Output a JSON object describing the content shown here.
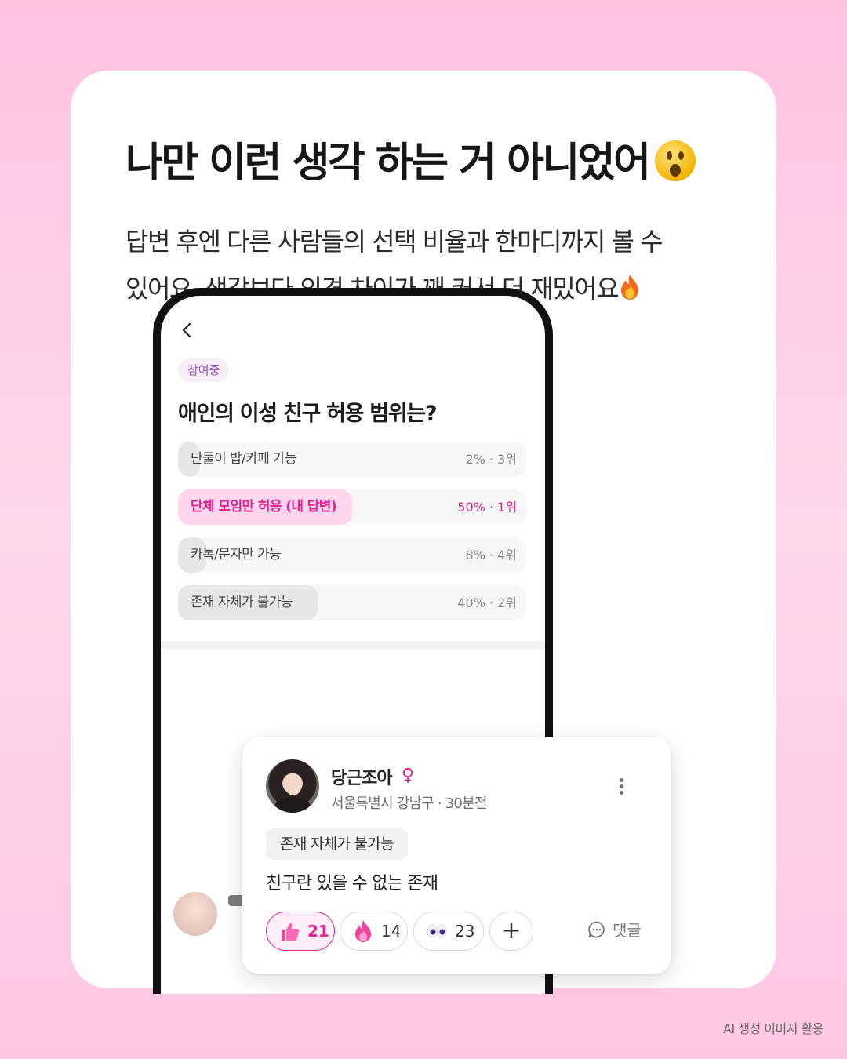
{
  "headline": "나만 이런 생각 하는 거 아니었어",
  "description": {
    "line1": "답변 후엔 다른 사람들의 선택 비율과 한마디까지 볼 수",
    "line2": "있어요. 생각보다 의견 차이가 꽤 커서 더 재밌어요"
  },
  "poll": {
    "status_badge": "참여중",
    "question": "애인의 이성 친구 허용 범위는?",
    "options": [
      {
        "label": "단둘이 밥/카페 가능",
        "stat": "2% · 3위",
        "percent": 2,
        "mine": false
      },
      {
        "label": "단체 모임만 허용 (내 답변)",
        "stat": "50% · 1위",
        "percent": 50,
        "mine": true
      },
      {
        "label": "카톡/문자만 가능",
        "stat": "8% · 4위",
        "percent": 8,
        "mine": false
      },
      {
        "label": "존재 자체가 불가능",
        "stat": "40% · 2위",
        "percent": 40,
        "mine": false
      }
    ]
  },
  "comment": {
    "user_name": "당근조아",
    "gender_symbol": "♀",
    "meta": "서울특별시 강남구 · 30분전",
    "choice": "존재 자체가 불가능",
    "text": "친구란 있을 수 없는 존재",
    "reactions": [
      {
        "icon": "thumbs-up-icon",
        "count": "21",
        "active": true
      },
      {
        "icon": "fire-icon",
        "count": "14",
        "active": false
      },
      {
        "icon": "eyes-icon",
        "count": "23",
        "active": false
      }
    ],
    "add_reaction": "+",
    "reply_label": "댓글"
  },
  "footnote": "AI 생성 이미지 활용",
  "colors": {
    "accent": "#e5208f",
    "accent_fill": "#ffd6ec",
    "badge_text": "#a24cc7",
    "background_pink": "#ffc3e1"
  }
}
